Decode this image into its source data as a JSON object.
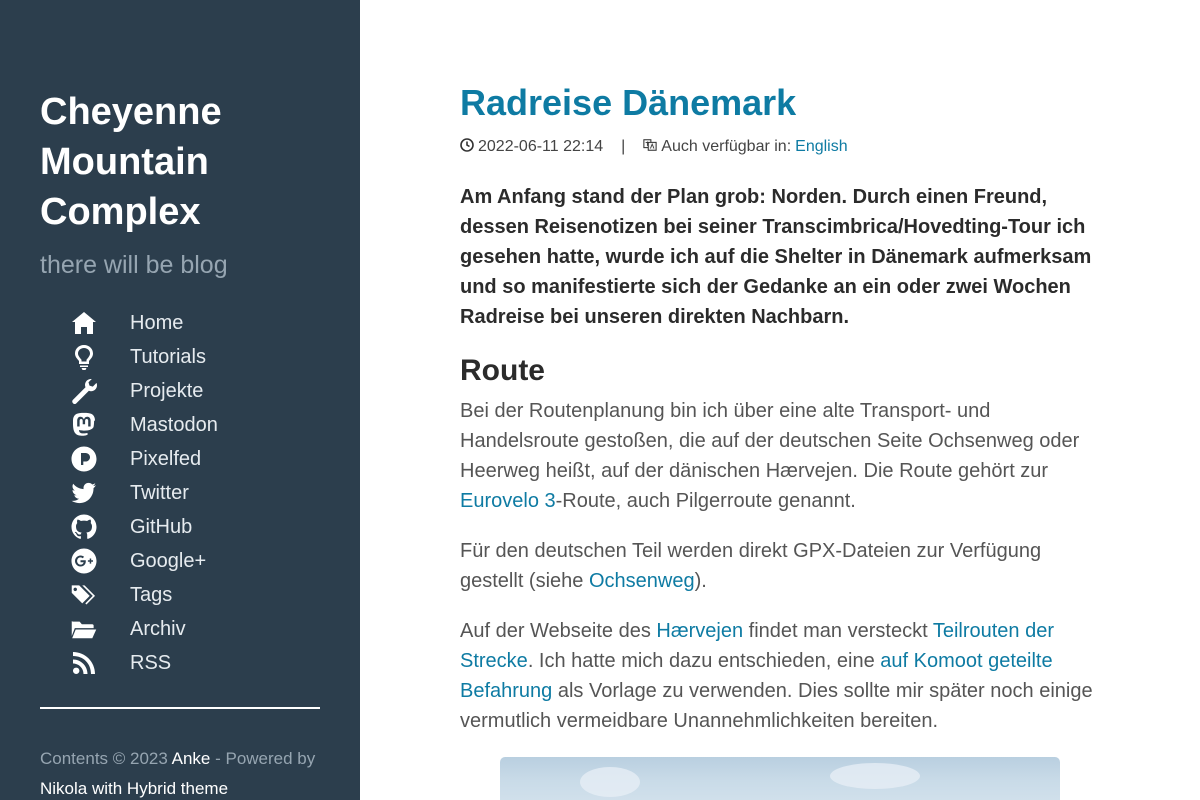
{
  "sidebar": {
    "site_title": "Cheyenne Mountain Complex",
    "tagline": "there will be blog",
    "nav": [
      {
        "label": "Home",
        "icon": "home-icon"
      },
      {
        "label": "Tutorials",
        "icon": "lightbulb-icon"
      },
      {
        "label": "Projekte",
        "icon": "wrench-icon"
      },
      {
        "label": "Mastodon",
        "icon": "mastodon-icon"
      },
      {
        "label": "Pixelfed",
        "icon": "pixelfed-icon"
      },
      {
        "label": "Twitter",
        "icon": "twitter-icon"
      },
      {
        "label": "GitHub",
        "icon": "github-icon"
      },
      {
        "label": "Google+",
        "icon": "google-plus-icon"
      },
      {
        "label": "Tags",
        "icon": "tags-icon"
      },
      {
        "label": "Archiv",
        "icon": "folder-open-icon"
      },
      {
        "label": "RSS",
        "icon": "rss-icon"
      }
    ],
    "footer": {
      "prefix": "Contents © 2023 ",
      "author": "Anke",
      "powered": " - Powered by ",
      "engine": "Nikola",
      "with": " with Hybrid theme"
    }
  },
  "post": {
    "title": "Radreise Dänemark",
    "date": "2022-06-11 22:14",
    "separator": "|",
    "also_available": "Auch verfügbar in:",
    "language_link": "English",
    "lead": "Am Anfang stand der Plan grob: Norden. Durch einen Freund, dessen Reisenotizen bei seiner Transcimbrica/Hovedting-Tour ich gesehen hatte, wurde ich auf die Shelter in Dänemark aufmerksam und so manifestierte sich der Gedanke an ein oder zwei Wochen Radreise bei unseren direkten Nachbarn.",
    "section_heading": "Route",
    "p1_text": "Bei der Routenplanung bin ich über eine alte Transport- und Handelsroute gestoßen, die auf der deutschen Seite Ochsenweg oder Heerweg heißt, auf der dänischen Hærvejen. Die Route gehört zur ",
    "p1_link": "Eurovelo 3",
    "p1_tail": "-Route, auch Pilgerroute genannt.",
    "p2_text": "Für den deutschen Teil werden direkt GPX-Dateien zur Verfügung gestellt (siehe ",
    "p2_link": "Ochsenweg",
    "p2_tail": ").",
    "p3_text": "Auf der Webseite des ",
    "p3_link1": "Hærvejen",
    "p3_mid1": " findet man versteckt ",
    "p3_link2": "Teilrouten der Strecke",
    "p3_mid2": ". Ich hatte mich dazu entschieden, eine ",
    "p3_link3": "auf Komoot geteilte Befahrung",
    "p3_tail": " als Vorlage zu verwenden. Dies sollte mir später noch einige vermutlich vermeidbare Unannehmlichkeiten bereiten."
  },
  "colors": {
    "sidebar_bg": "#2c3e4d",
    "link": "#0e7ba3",
    "tagline": "#96a5b1"
  }
}
